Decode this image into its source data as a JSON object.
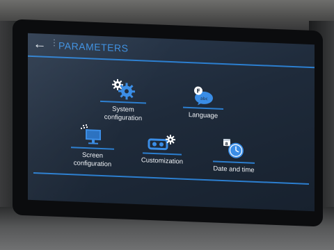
{
  "header": {
    "back_icon": "back-arrow-icon",
    "title": "PARAMETERS"
  },
  "tiles": [
    {
      "label_line1": "System",
      "label_line2": "configuration",
      "icon": "gears-icon"
    },
    {
      "label_line1": "Language",
      "label_line2": "",
      "icon": "speech-bubble-icon"
    },
    {
      "label_line1": "Screen",
      "label_line2": "configuration",
      "icon": "monitor-icon"
    },
    {
      "label_line1": "Customization",
      "label_line2": "",
      "icon": "cassette-gear-icon"
    },
    {
      "label_line1": "Date and time",
      "label_line2": "",
      "icon": "clock-calendar-icon"
    }
  ],
  "colors": {
    "accent": "#2c7fd0",
    "title": "#3c8fe0",
    "text": "#f0f3f7",
    "screen_bg": "#1f2b3b"
  }
}
